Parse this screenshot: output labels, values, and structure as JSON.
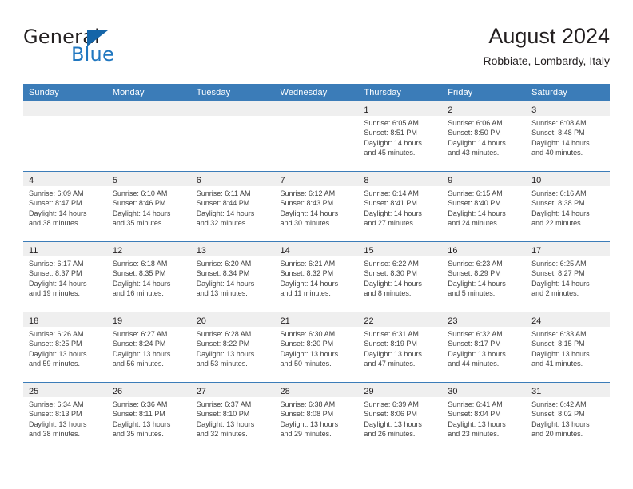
{
  "brand": {
    "name_part1": "General",
    "name_part2": "Blue",
    "accent_color": "#2077c0",
    "triangle_color": "#1565a8"
  },
  "header": {
    "title": "August 2024",
    "subtitle": "Robbiate, Lombardy, Italy"
  },
  "theme": {
    "header_blue": "#3b7cb8",
    "day_band_gray": "#efefef",
    "text_color": "#231f20"
  },
  "weekday_headers": [
    "Sunday",
    "Monday",
    "Tuesday",
    "Wednesday",
    "Thursday",
    "Friday",
    "Saturday"
  ],
  "weeks": [
    [
      {
        "day": "",
        "empty": true
      },
      {
        "day": "",
        "empty": true
      },
      {
        "day": "",
        "empty": true
      },
      {
        "day": "",
        "empty": true
      },
      {
        "day": "1",
        "sunrise": "Sunrise: 6:05 AM",
        "sunset": "Sunset: 8:51 PM",
        "daylight1": "Daylight: 14 hours",
        "daylight2": "and 45 minutes."
      },
      {
        "day": "2",
        "sunrise": "Sunrise: 6:06 AM",
        "sunset": "Sunset: 8:50 PM",
        "daylight1": "Daylight: 14 hours",
        "daylight2": "and 43 minutes."
      },
      {
        "day": "3",
        "sunrise": "Sunrise: 6:08 AM",
        "sunset": "Sunset: 8:48 PM",
        "daylight1": "Daylight: 14 hours",
        "daylight2": "and 40 minutes."
      }
    ],
    [
      {
        "day": "4",
        "sunrise": "Sunrise: 6:09 AM",
        "sunset": "Sunset: 8:47 PM",
        "daylight1": "Daylight: 14 hours",
        "daylight2": "and 38 minutes."
      },
      {
        "day": "5",
        "sunrise": "Sunrise: 6:10 AM",
        "sunset": "Sunset: 8:46 PM",
        "daylight1": "Daylight: 14 hours",
        "daylight2": "and 35 minutes."
      },
      {
        "day": "6",
        "sunrise": "Sunrise: 6:11 AM",
        "sunset": "Sunset: 8:44 PM",
        "daylight1": "Daylight: 14 hours",
        "daylight2": "and 32 minutes."
      },
      {
        "day": "7",
        "sunrise": "Sunrise: 6:12 AM",
        "sunset": "Sunset: 8:43 PM",
        "daylight1": "Daylight: 14 hours",
        "daylight2": "and 30 minutes."
      },
      {
        "day": "8",
        "sunrise": "Sunrise: 6:14 AM",
        "sunset": "Sunset: 8:41 PM",
        "daylight1": "Daylight: 14 hours",
        "daylight2": "and 27 minutes."
      },
      {
        "day": "9",
        "sunrise": "Sunrise: 6:15 AM",
        "sunset": "Sunset: 8:40 PM",
        "daylight1": "Daylight: 14 hours",
        "daylight2": "and 24 minutes."
      },
      {
        "day": "10",
        "sunrise": "Sunrise: 6:16 AM",
        "sunset": "Sunset: 8:38 PM",
        "daylight1": "Daylight: 14 hours",
        "daylight2": "and 22 minutes."
      }
    ],
    [
      {
        "day": "11",
        "sunrise": "Sunrise: 6:17 AM",
        "sunset": "Sunset: 8:37 PM",
        "daylight1": "Daylight: 14 hours",
        "daylight2": "and 19 minutes."
      },
      {
        "day": "12",
        "sunrise": "Sunrise: 6:18 AM",
        "sunset": "Sunset: 8:35 PM",
        "daylight1": "Daylight: 14 hours",
        "daylight2": "and 16 minutes."
      },
      {
        "day": "13",
        "sunrise": "Sunrise: 6:20 AM",
        "sunset": "Sunset: 8:34 PM",
        "daylight1": "Daylight: 14 hours",
        "daylight2": "and 13 minutes."
      },
      {
        "day": "14",
        "sunrise": "Sunrise: 6:21 AM",
        "sunset": "Sunset: 8:32 PM",
        "daylight1": "Daylight: 14 hours",
        "daylight2": "and 11 minutes."
      },
      {
        "day": "15",
        "sunrise": "Sunrise: 6:22 AM",
        "sunset": "Sunset: 8:30 PM",
        "daylight1": "Daylight: 14 hours",
        "daylight2": "and 8 minutes."
      },
      {
        "day": "16",
        "sunrise": "Sunrise: 6:23 AM",
        "sunset": "Sunset: 8:29 PM",
        "daylight1": "Daylight: 14 hours",
        "daylight2": "and 5 minutes."
      },
      {
        "day": "17",
        "sunrise": "Sunrise: 6:25 AM",
        "sunset": "Sunset: 8:27 PM",
        "daylight1": "Daylight: 14 hours",
        "daylight2": "and 2 minutes."
      }
    ],
    [
      {
        "day": "18",
        "sunrise": "Sunrise: 6:26 AM",
        "sunset": "Sunset: 8:25 PM",
        "daylight1": "Daylight: 13 hours",
        "daylight2": "and 59 minutes."
      },
      {
        "day": "19",
        "sunrise": "Sunrise: 6:27 AM",
        "sunset": "Sunset: 8:24 PM",
        "daylight1": "Daylight: 13 hours",
        "daylight2": "and 56 minutes."
      },
      {
        "day": "20",
        "sunrise": "Sunrise: 6:28 AM",
        "sunset": "Sunset: 8:22 PM",
        "daylight1": "Daylight: 13 hours",
        "daylight2": "and 53 minutes."
      },
      {
        "day": "21",
        "sunrise": "Sunrise: 6:30 AM",
        "sunset": "Sunset: 8:20 PM",
        "daylight1": "Daylight: 13 hours",
        "daylight2": "and 50 minutes."
      },
      {
        "day": "22",
        "sunrise": "Sunrise: 6:31 AM",
        "sunset": "Sunset: 8:19 PM",
        "daylight1": "Daylight: 13 hours",
        "daylight2": "and 47 minutes."
      },
      {
        "day": "23",
        "sunrise": "Sunrise: 6:32 AM",
        "sunset": "Sunset: 8:17 PM",
        "daylight1": "Daylight: 13 hours",
        "daylight2": "and 44 minutes."
      },
      {
        "day": "24",
        "sunrise": "Sunrise: 6:33 AM",
        "sunset": "Sunset: 8:15 PM",
        "daylight1": "Daylight: 13 hours",
        "daylight2": "and 41 minutes."
      }
    ],
    [
      {
        "day": "25",
        "sunrise": "Sunrise: 6:34 AM",
        "sunset": "Sunset: 8:13 PM",
        "daylight1": "Daylight: 13 hours",
        "daylight2": "and 38 minutes."
      },
      {
        "day": "26",
        "sunrise": "Sunrise: 6:36 AM",
        "sunset": "Sunset: 8:11 PM",
        "daylight1": "Daylight: 13 hours",
        "daylight2": "and 35 minutes."
      },
      {
        "day": "27",
        "sunrise": "Sunrise: 6:37 AM",
        "sunset": "Sunset: 8:10 PM",
        "daylight1": "Daylight: 13 hours",
        "daylight2": "and 32 minutes."
      },
      {
        "day": "28",
        "sunrise": "Sunrise: 6:38 AM",
        "sunset": "Sunset: 8:08 PM",
        "daylight1": "Daylight: 13 hours",
        "daylight2": "and 29 minutes."
      },
      {
        "day": "29",
        "sunrise": "Sunrise: 6:39 AM",
        "sunset": "Sunset: 8:06 PM",
        "daylight1": "Daylight: 13 hours",
        "daylight2": "and 26 minutes."
      },
      {
        "day": "30",
        "sunrise": "Sunrise: 6:41 AM",
        "sunset": "Sunset: 8:04 PM",
        "daylight1": "Daylight: 13 hours",
        "daylight2": "and 23 minutes."
      },
      {
        "day": "31",
        "sunrise": "Sunrise: 6:42 AM",
        "sunset": "Sunset: 8:02 PM",
        "daylight1": "Daylight: 13 hours",
        "daylight2": "and 20 minutes."
      }
    ]
  ]
}
